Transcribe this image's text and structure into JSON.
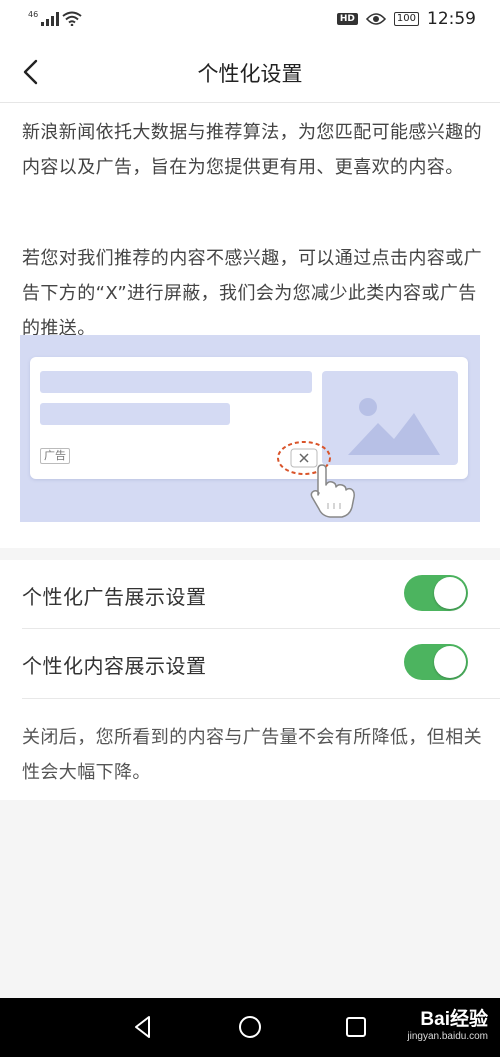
{
  "status_bar": {
    "signal_label": "46",
    "hd_badge": "HD",
    "battery": "100",
    "time": "12:59"
  },
  "header": {
    "title": "个性化设置",
    "back_icon": "chevron-left-icon"
  },
  "intro": {
    "paragraph1": "新浪新闻依托大数据与推荐算法，为您匹配可能感兴趣的内容以及广告，旨在为您提供更有用、更喜欢的内容。",
    "paragraph2": "若您对我们推荐的内容不感兴趣，可以通过点击内容或广告下方的“X”进行屏蔽，我们会为您减少此类内容或广告的推送。"
  },
  "illustration": {
    "ad_tag": "广告",
    "close_icon": "close-x-icon",
    "image_icon": "image-placeholder-icon",
    "hand_icon": "pointing-hand-icon",
    "background_color": "#d4daf3"
  },
  "settings": {
    "items": [
      {
        "label": "个性化广告展示设置",
        "enabled": true
      },
      {
        "label": "个性化内容展示设置",
        "enabled": true
      }
    ],
    "note": "关闭后，您所看到的内容与广告量不会有所降低，但相关性会大幅下降。"
  },
  "nav_bar": {
    "back_icon": "nav-back-triangle-icon",
    "home_icon": "nav-home-circle-icon",
    "recent_icon": "nav-recent-square-icon"
  },
  "watermark": {
    "logo": "Bai经验",
    "url": "jingyan.baidu.com"
  },
  "colors": {
    "toggle_on": "#4cb45f",
    "illustration_bg": "#d4daf3",
    "dashed_highlight": "#d9542a"
  }
}
